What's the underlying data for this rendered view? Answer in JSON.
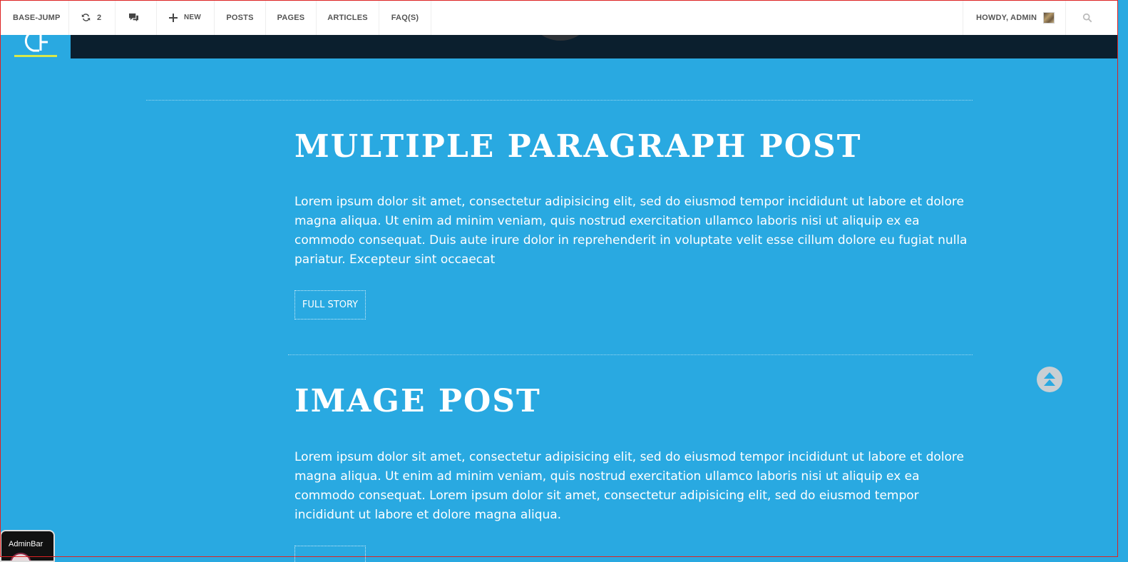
{
  "adminbar": {
    "site_name": "BASE-JUMP",
    "updates_count": "2",
    "new_label": "NEW",
    "menu": [
      "POSTS",
      "PAGES",
      "ARTICLES",
      "FAQ(S)"
    ],
    "greeting": "HOWDY, ADMIN"
  },
  "posts": [
    {
      "title": "MULTIPLE PARAGRAPH POST",
      "excerpt": "Lorem ipsum dolor sit amet, consectetur adipisicing elit, sed do eiusmod tempor incididunt ut labore et dolore magna aliqua. Ut enim ad minim veniam, quis nostrud exercitation ullamco laboris nisi ut aliquip ex ea commodo consequat. Duis aute irure dolor in reprehenderit in voluptate velit esse cillum dolore eu fugiat nulla pariatur. Excepteur sint occaecat",
      "button": "FULL STORY"
    },
    {
      "title": "IMAGE POST",
      "excerpt": "Lorem ipsum dolor sit amet, consectetur adipisicing elit, sed do eiusmod tempor incididunt ut labore et dolore magna aliqua. Ut enim ad minim veniam, quis nostrud exercitation ullamco laboris nisi ut aliquip ex ea commodo consequat. Lorem ipsum dolor sit amet, consectetur adipisicing elit, sed do eiusmod tempor incididunt ut labore et dolore magna aliqua.",
      "button": ""
    }
  ],
  "adminbar_tab": "AdminBar",
  "colors": {
    "content_background": "#29a9e1",
    "header_background": "#0b1f2e",
    "logo_accent": "#d8e84a"
  },
  "icons": [
    "refresh-icon",
    "comments-icon",
    "plus-icon",
    "search-icon",
    "scroll-to-top-icon"
  ]
}
